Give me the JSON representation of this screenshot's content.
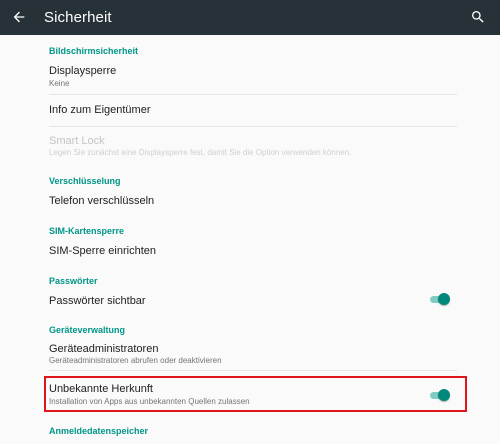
{
  "appbar": {
    "title": "Sicherheit",
    "back_icon": "arrow-left-icon",
    "search_icon": "search-icon"
  },
  "sections": {
    "screen": "Bildschirmsicherheit",
    "encryption": "Verschlüsselung",
    "sim": "SIM-Kartensperre",
    "passwords": "Passwörter",
    "device_admin": "Geräteverwaltung",
    "credentials": "Anmeldedatenspeicher"
  },
  "items": {
    "screen_lock": {
      "title": "Displaysperre",
      "summary": "Keine"
    },
    "owner_info": {
      "title": "Info zum Eigentümer"
    },
    "smart_lock": {
      "title": "Smart Lock",
      "summary": "Legen Sie zunächst eine Displaysperre fest, damit Sie die Option verwenden können."
    },
    "encrypt_phone": {
      "title": "Telefon verschlüsseln"
    },
    "sim_lock": {
      "title": "SIM-Sperre einrichten"
    },
    "show_passwords": {
      "title": "Passwörter sichtbar",
      "enabled": true
    },
    "device_admins": {
      "title": "Geräteadministratoren",
      "summary": "Geräteadministratoren abrufen oder deaktivieren"
    },
    "unknown_sources": {
      "title": "Unbekannte Herkunft",
      "summary": "Installation von Apps aus unbekannten Quellen zulassen",
      "enabled": true
    }
  },
  "colors": {
    "appbar": "#263238",
    "accent": "#009688",
    "highlight": "#e0141b"
  }
}
